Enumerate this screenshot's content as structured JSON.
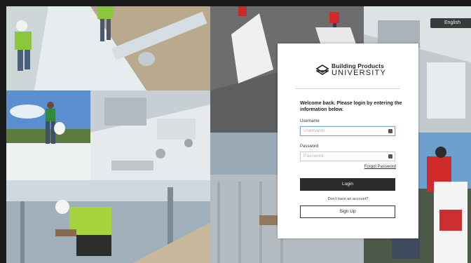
{
  "language": {
    "label": "English"
  },
  "brand": {
    "line1": "Building Products",
    "line2": "UNIVERSITY"
  },
  "login": {
    "welcome": "Welcome back. Please login by entering the information below.",
    "username_label": "Username",
    "username_placeholder": "Username",
    "password_label": "Password",
    "password_placeholder": "Password",
    "forgot_password": "Forgot Password",
    "login_button": "Login",
    "no_account": "Don't have an account?",
    "signup_button": "Sign Up"
  },
  "colors": {
    "card_bg": "#ffffff",
    "login_button_bg": "#2b2b2b",
    "input_focus_border": "#7fa6d9",
    "shirt_green": "#8cc63f"
  },
  "icons": [
    "brand-logo-icon",
    "username-field-icon",
    "password-field-icon"
  ]
}
